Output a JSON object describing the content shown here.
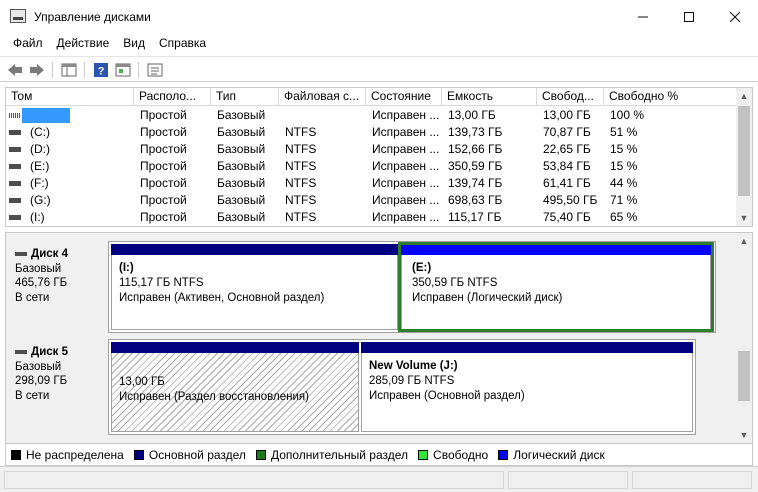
{
  "window": {
    "title": "Управление дисками"
  },
  "menu": [
    "Файл",
    "Действие",
    "Вид",
    "Справка"
  ],
  "toolbar": {
    "icons": [
      "back-arrow-icon",
      "forward-arrow-icon",
      "show-hide-tree-icon",
      "help-icon",
      "properties-icon",
      "action-list-icon"
    ]
  },
  "volumes": {
    "columns": [
      "Том",
      "Располо...",
      "Тип",
      "Файловая с...",
      "Состояние",
      "Емкость",
      "Свобод...",
      "Свободно %"
    ],
    "rows": [
      {
        "name": "",
        "layout": "Простой",
        "type": "Базовый",
        "fs": "",
        "status": "Исправен ...",
        "capacity": "13,00 ГБ",
        "free": "13,00 ГБ",
        "free_pct": "100 %"
      },
      {
        "name": "(C:)",
        "layout": "Простой",
        "type": "Базовый",
        "fs": "NTFS",
        "status": "Исправен ...",
        "capacity": "139,73 ГБ",
        "free": "70,87 ГБ",
        "free_pct": "51 %"
      },
      {
        "name": "(D:)",
        "layout": "Простой",
        "type": "Базовый",
        "fs": "NTFS",
        "status": "Исправен ...",
        "capacity": "152,66 ГБ",
        "free": "22,65 ГБ",
        "free_pct": "15 %"
      },
      {
        "name": "(E:)",
        "layout": "Простой",
        "type": "Базовый",
        "fs": "NTFS",
        "status": "Исправен ...",
        "capacity": "350,59 ГБ",
        "free": "53,84 ГБ",
        "free_pct": "15 %"
      },
      {
        "name": "(F:)",
        "layout": "Простой",
        "type": "Базовый",
        "fs": "NTFS",
        "status": "Исправен ...",
        "capacity": "139,74 ГБ",
        "free": "61,41 ГБ",
        "free_pct": "44 %"
      },
      {
        "name": "(G:)",
        "layout": "Простой",
        "type": "Базовый",
        "fs": "NTFS",
        "status": "Исправен ...",
        "capacity": "698,63 ГБ",
        "free": "495,50 ГБ",
        "free_pct": "71 %"
      },
      {
        "name": "(I:)",
        "layout": "Простой",
        "type": "Базовый",
        "fs": "NTFS",
        "status": "Исправен ...",
        "capacity": "115,17 ГБ",
        "free": "75,40 ГБ",
        "free_pct": "65 %"
      }
    ]
  },
  "disks": [
    {
      "name": "Диск 4",
      "type": "Базовый",
      "size": "465,76 ГБ",
      "state": "В сети",
      "partitions": [
        {
          "title": "(I:)",
          "size": "115,17 ГБ NTFS",
          "status": "Исправен (Активен, Основной раздел)"
        },
        {
          "title": "(E:)",
          "size": "350,59 ГБ NTFS",
          "status": "Исправен (Логический диск)"
        }
      ]
    },
    {
      "name": "Диск 5",
      "type": "Базовый",
      "size": "298,09 ГБ",
      "state": "В сети",
      "partitions": [
        {
          "title": "",
          "size": "13,00 ГБ",
          "status": "Исправен (Раздел восстановления)"
        },
        {
          "title": "New Volume  (J:)",
          "size": "285,09 ГБ NTFS",
          "status": "Исправен (Основной раздел)"
        }
      ]
    }
  ],
  "legend": [
    {
      "label": "Не распределена",
      "color": "#000000"
    },
    {
      "label": "Основной раздел",
      "color": "#000080"
    },
    {
      "label": "Дополнительный раздел",
      "color": "#1a7a1a"
    },
    {
      "label": "Свободно",
      "color": "#33e633"
    },
    {
      "label": "Логический диск",
      "color": "#0000ff"
    }
  ],
  "colors": {
    "primary_partition": "#000080",
    "logical_drive": "#0000ff",
    "selection_frame": "#2c7d2c",
    "list_selection": "#3399ff"
  }
}
